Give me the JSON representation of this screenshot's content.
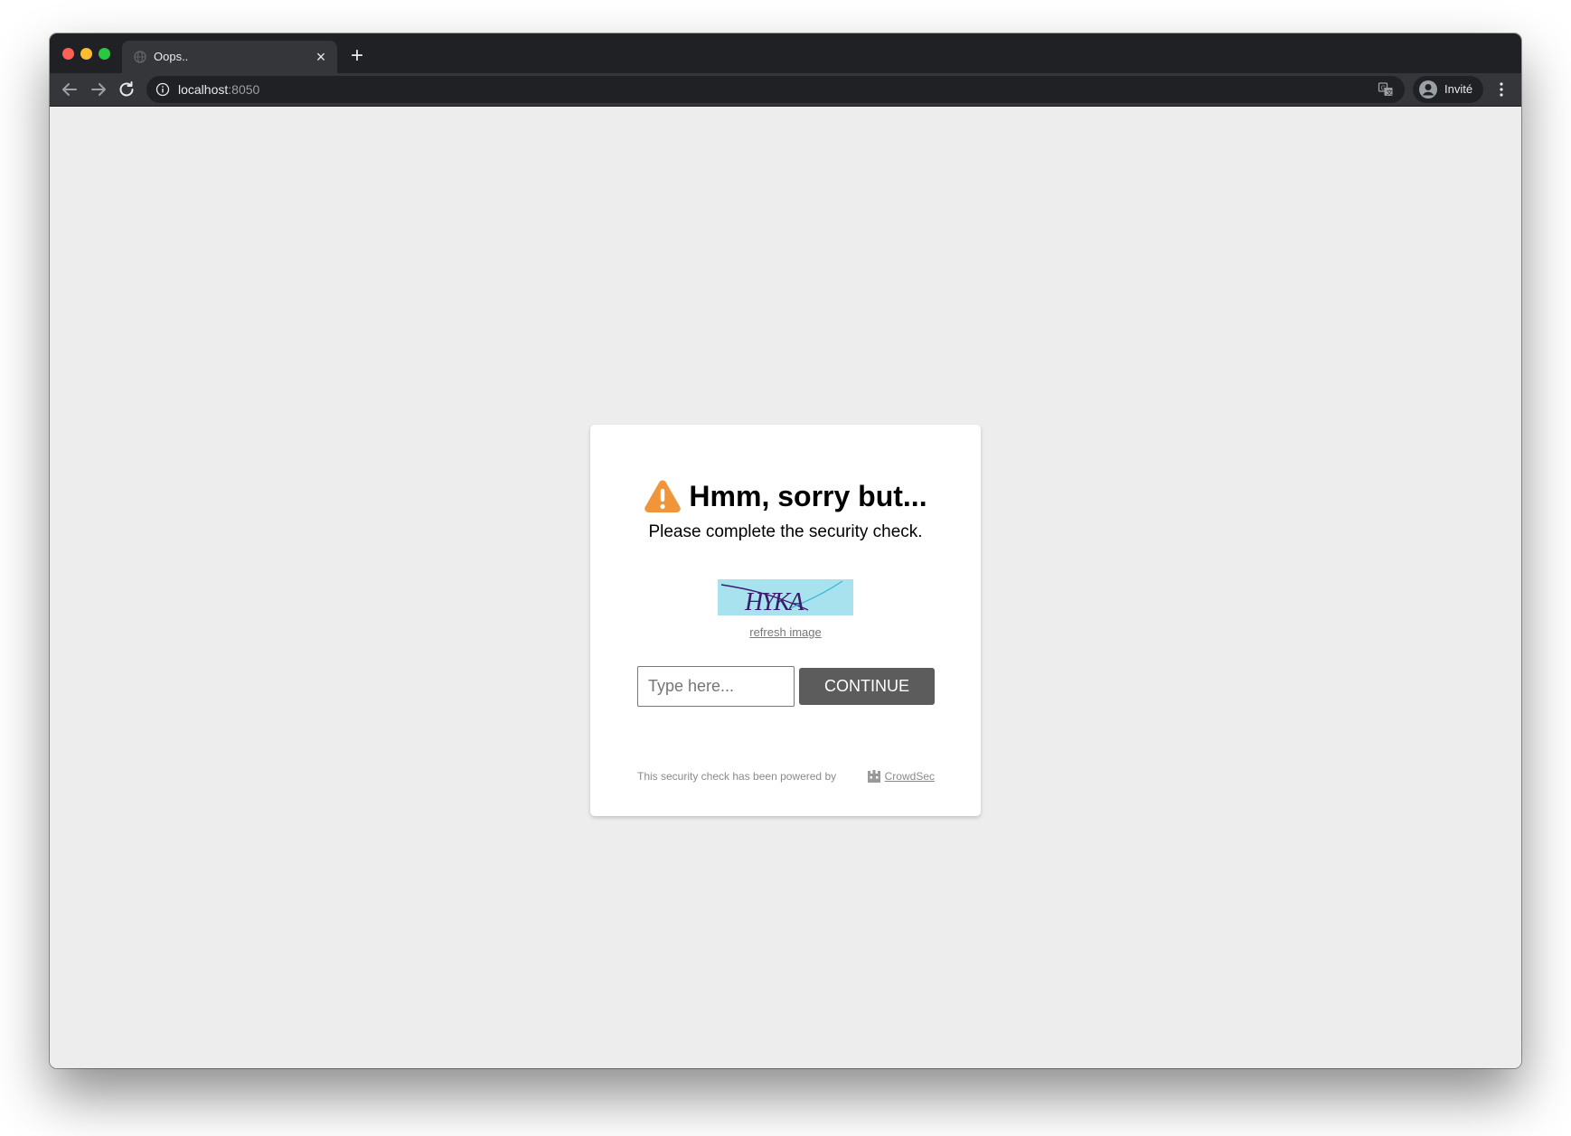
{
  "browser": {
    "tab": {
      "title": "Oops.."
    },
    "address_bar": {
      "host": "localhost",
      "port": ":8050"
    },
    "profile": {
      "label": "Invité"
    }
  },
  "page": {
    "heading": "Hmm, sorry but...",
    "subtitle": "Please complete the security check.",
    "captcha": {
      "text": "HYKA",
      "background_color": "#a8e2ee",
      "text_color": "#3b1a6b"
    },
    "refresh_link": "refresh image",
    "input": {
      "placeholder": "Type here...",
      "value": ""
    },
    "continue_button": "CONTINUE",
    "footer": {
      "powered_by": "This security check has been powered by",
      "provider": "CrowdSec"
    }
  },
  "colors": {
    "warning": "#f0953a",
    "button": "#5c5c5c",
    "page_background": "#ededed"
  }
}
